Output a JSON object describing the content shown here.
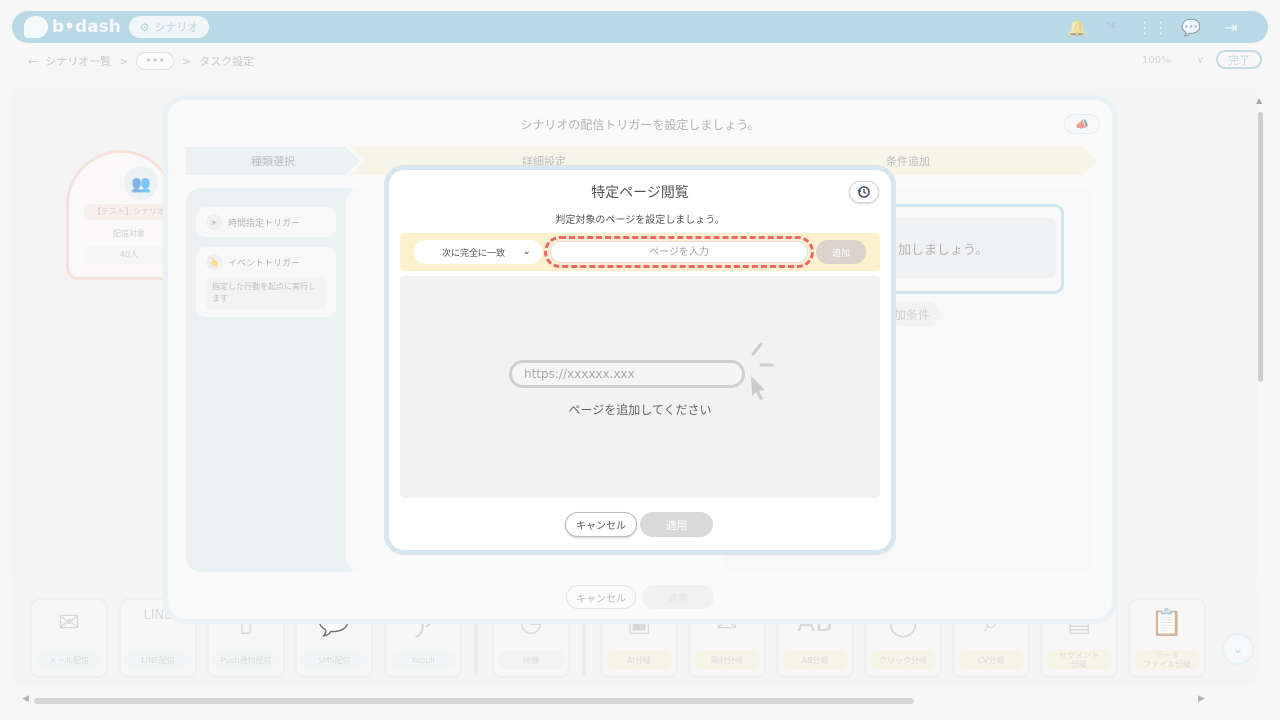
{
  "header": {
    "logo_text": "b•dash",
    "scenario_pill": "シナリオ",
    "icons": [
      "bell-icon",
      "wrench-icon",
      "grid-icon",
      "help-bubble-icon",
      "logout-icon"
    ]
  },
  "breadcrumb": {
    "back": "←",
    "list": "シナリオ一覧",
    "sep1": ">",
    "more": "•••",
    "sep2": ">",
    "current": "タスク設定"
  },
  "toolbar": {
    "zoom": "100%",
    "zoom_caret": "∨",
    "done": "完了"
  },
  "start_node": {
    "title": "【テスト】シナリオ",
    "sub": "配信対象",
    "count": "40人"
  },
  "palette": {
    "items": [
      {
        "label": "メール配信",
        "icon": "✉"
      },
      {
        "label": "LINE配信",
        "icon": "LINE"
      },
      {
        "label": "Push通知配信",
        "icon": "▯"
      },
      {
        "label": "SMS配信",
        "icon": "💬"
      },
      {
        "label": "Yappli",
        "icon": "ア"
      },
      {
        "label": "待機",
        "icon": "◷"
      },
      {
        "label": "AI分岐",
        "icon": "▣"
      },
      {
        "label": "開封分岐",
        "icon": "✉"
      },
      {
        "label": "AB分岐",
        "icon": "AB"
      },
      {
        "label": "クリック分岐",
        "icon": "◯"
      },
      {
        "label": "CV分岐",
        "icon": "⌕"
      },
      {
        "label": "セグメント\n分岐",
        "icon": "▤"
      },
      {
        "label": "データ\nファイル分岐",
        "icon": "📋"
      }
    ],
    "scroll_down": "⌄",
    "scroll_left": "◀",
    "scroll_right": "▶"
  },
  "outer_dialog": {
    "title": "シナリオの配信トリガーを設定しましょう。",
    "steps": [
      "種類選択",
      "詳細設定",
      "条件追加"
    ],
    "triggers": [
      {
        "label": "時間指定トリガー",
        "icon": "➤"
      },
      {
        "label": "イベントトリガー",
        "icon": "👆",
        "desc": "指定した行動を起点に実行します"
      }
    ],
    "condition_text": "加しましょう。",
    "add_condition": "加条件",
    "cancel": "キャンセル",
    "apply": "適用"
  },
  "modal": {
    "title": "特定ページ閲覧",
    "subtitle": "判定対象のページを設定しましょう。",
    "match_select": "次に完全に一致",
    "match_caret": "⌄",
    "input_placeholder": "ページを入力",
    "add_button": "追加",
    "url_example": "https://xxxxxx.xxx",
    "empty_text": "ページを追加してください",
    "cancel": "キャンセル",
    "apply": "適用"
  },
  "colors": {
    "header": "#5ea9c9",
    "highlight_dash": "#ee6666",
    "accent": "#66aabb"
  }
}
